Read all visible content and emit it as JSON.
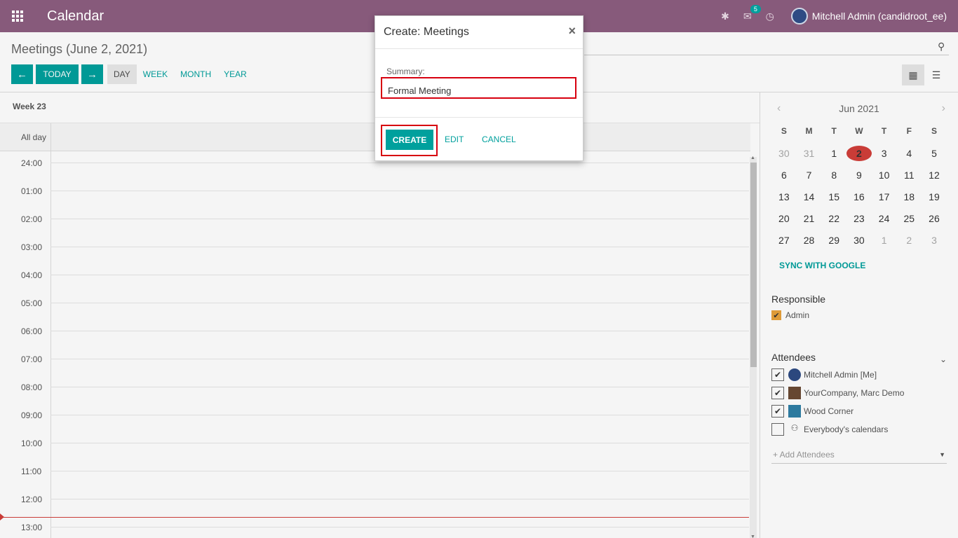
{
  "navbar": {
    "app_title": "Calendar",
    "badge_count": "5",
    "user_name": "Mitchell Admin (candidroot_ee)"
  },
  "control_panel": {
    "breadcrumb": "Meetings (June 2, 2021)",
    "today_label": "TODAY",
    "views": [
      "DAY",
      "WEEK",
      "MONTH",
      "YEAR"
    ],
    "active_view": "DAY"
  },
  "calendar": {
    "week_label": "Week 23",
    "allday_label": "All day",
    "hours": [
      "24:00",
      "01:00",
      "02:00",
      "03:00",
      "04:00",
      "05:00",
      "06:00",
      "07:00",
      "08:00",
      "09:00",
      "10:00",
      "11:00",
      "12:00",
      "13:00"
    ]
  },
  "sidebar": {
    "month_title": "Jun 2021",
    "days_of_week": [
      "S",
      "M",
      "T",
      "W",
      "T",
      "F",
      "S"
    ],
    "weeks": [
      [
        "30",
        "31",
        "1",
        "2",
        "3",
        "4",
        "5"
      ],
      [
        "6",
        "7",
        "8",
        "9",
        "10",
        "11",
        "12"
      ],
      [
        "13",
        "14",
        "15",
        "16",
        "17",
        "18",
        "19"
      ],
      [
        "20",
        "21",
        "22",
        "23",
        "24",
        "25",
        "26"
      ],
      [
        "27",
        "28",
        "29",
        "30",
        "1",
        "2",
        "3"
      ]
    ],
    "selected_day": "2",
    "sync_label": "SYNC WITH GOOGLE",
    "responsible_title": "Responsible",
    "responsible_items": [
      "Admin"
    ],
    "attendees_title": "Attendees",
    "attendees": [
      {
        "name": "Mitchell Admin [Me]",
        "checked": true
      },
      {
        "name": "YourCompany, Marc Demo",
        "checked": true
      },
      {
        "name": "Wood Corner",
        "checked": true
      },
      {
        "name": "Everybody's calendars",
        "checked": false
      }
    ],
    "add_attendees_placeholder": "+ Add Attendees"
  },
  "modal": {
    "title": "Create: Meetings",
    "close_glyph": "×",
    "summary_label": "Summary:",
    "summary_value": "Formal Meeting",
    "create_label": "CREATE",
    "edit_label": "EDIT",
    "cancel_label": "CANCEL"
  },
  "colors": {
    "navbar": "#875a7b",
    "accent": "#00a09d",
    "today": "#d23f3a",
    "highlight": "#d7000f"
  }
}
